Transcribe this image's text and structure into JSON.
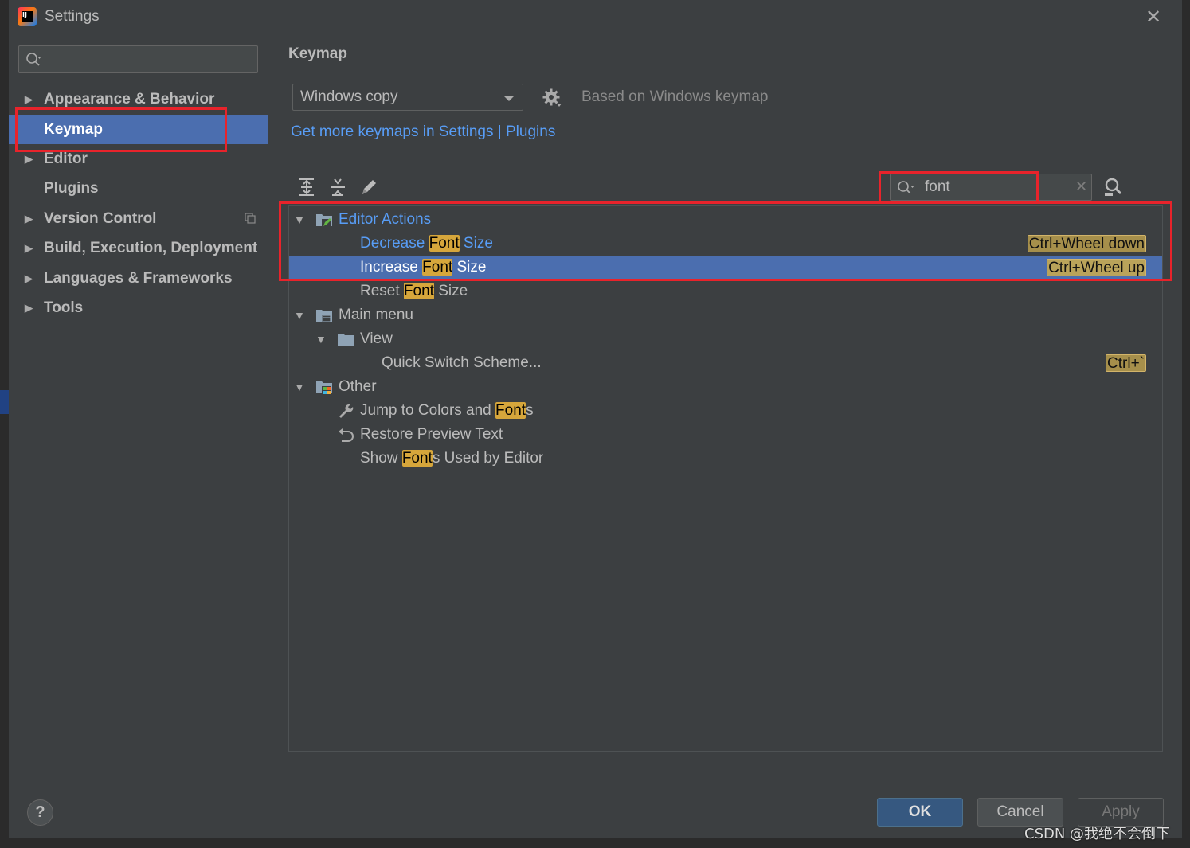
{
  "window": {
    "title": "Settings"
  },
  "sidebar": {
    "search_value": "",
    "items": [
      {
        "label": "Appearance & Behavior",
        "expandable": true,
        "selected": false
      },
      {
        "label": "Keymap",
        "expandable": false,
        "selected": true
      },
      {
        "label": "Editor",
        "expandable": true,
        "selected": false
      },
      {
        "label": "Plugins",
        "expandable": false,
        "selected": false
      },
      {
        "label": "Version Control",
        "expandable": true,
        "selected": false
      },
      {
        "label": "Build, Execution, Deployment",
        "expandable": true,
        "selected": false
      },
      {
        "label": "Languages & Frameworks",
        "expandable": true,
        "selected": false
      },
      {
        "label": "Tools",
        "expandable": true,
        "selected": false
      }
    ]
  },
  "keymap": {
    "title": "Keymap",
    "selected_scheme": "Windows copy",
    "based_on": "Based on Windows keymap",
    "more_link_prefix": "Get more keymaps in Settings",
    "more_link_separator": " | ",
    "more_link_plugins": "Plugins",
    "filter_value": "font",
    "tree": {
      "editor_actions": {
        "label": "Editor Actions",
        "items": [
          {
            "pre": "Decrease ",
            "match": "Font",
            "post": " Size",
            "shortcut": "Ctrl+Wheel down"
          },
          {
            "pre": "Increase ",
            "match": "Font",
            "post": " Size",
            "shortcut": "Ctrl+Wheel up"
          },
          {
            "pre": "Reset ",
            "match": "Font",
            "post": " Size",
            "shortcut": ""
          }
        ]
      },
      "main_menu": {
        "label": "Main menu",
        "view": {
          "label": "View",
          "items": [
            {
              "label": "Quick Switch Scheme...",
              "shortcut": "Ctrl+`"
            }
          ]
        }
      },
      "other": {
        "label": "Other",
        "items": [
          {
            "pre": "Jump to Colors and ",
            "match": "Font",
            "post": "s",
            "icon": "wrench-icon"
          },
          {
            "pre": "Restore Preview Text",
            "match": "",
            "post": "",
            "icon": "undo-icon"
          },
          {
            "pre": "Show ",
            "match": "Font",
            "post": "s Used by Editor",
            "icon": ""
          }
        ]
      }
    }
  },
  "footer": {
    "help": "?",
    "ok": "OK",
    "cancel": "Cancel",
    "apply": "Apply"
  },
  "watermark": "CSDN @我绝不会倒下",
  "colors": {
    "background": "#3c3f41",
    "selection": "#4b6eaf",
    "link": "#589df6",
    "search_match": "#d6a63b",
    "annotation_box": "#e8232b"
  }
}
